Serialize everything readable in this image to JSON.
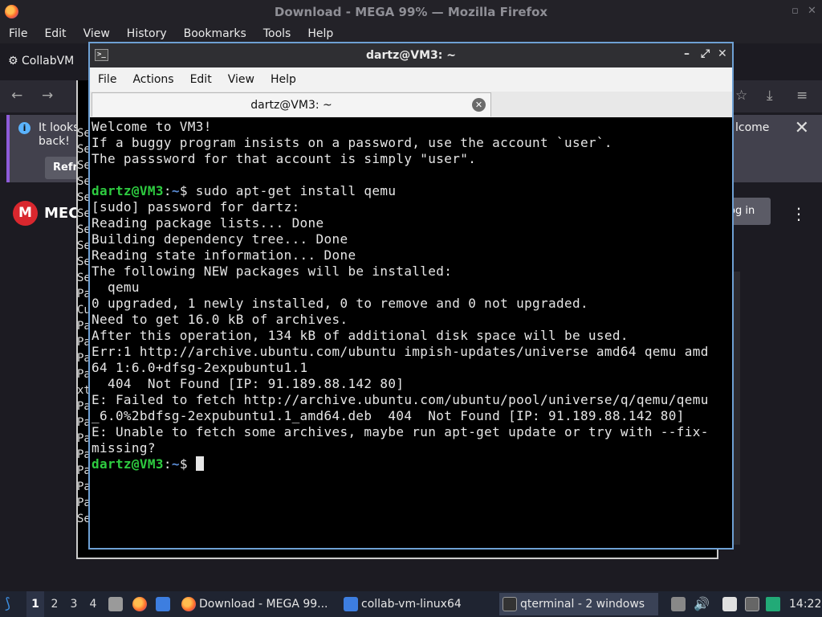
{
  "firefox": {
    "title": "Download - MEGA 99% — Mozilla Firefox",
    "menu": [
      "File",
      "Edit",
      "View",
      "History",
      "Bookmarks",
      "Tools",
      "Help"
    ],
    "tab_label": "CollabVM",
    "notification": {
      "line1": "It looks",
      "line2": "back!",
      "button": "Refresh",
      "right_text": "lcome"
    },
    "mega": {
      "logo_letter": "M",
      "brand_text": "MEC",
      "login_label": "og in"
    }
  },
  "bg_terminal": {
    "left_chars": [
      "Se",
      "Se",
      "Se",
      "Se",
      "Se",
      "Se",
      "Se",
      "Se",
      "Se",
      "Se",
      "Pa",
      "Cu",
      "Pa",
      "Pa",
      "Pa",
      "Pa",
      "xt",
      "Pa",
      "Pa",
      "Pa",
      "Pa",
      "Pa",
      "Pa",
      "Pa",
      "Se"
    ]
  },
  "qterminal": {
    "window_title": "dartz@VM3: ~",
    "menu": [
      "File",
      "Actions",
      "Edit",
      "View",
      "Help"
    ],
    "tab_title": "dartz@VM3: ~",
    "prompt_user": "dartz@VM3",
    "prompt_path": "~",
    "command": "sudo apt-get install qemu",
    "lines": [
      "Welcome to VM3!",
      "If a buggy program insists on a password, use the account `user`.",
      "The passsword for that account is simply \"user\".",
      "",
      "",
      "[sudo] password for dartz:",
      "Reading package lists... Done",
      "Building dependency tree... Done",
      "Reading state information... Done",
      "The following NEW packages will be installed:",
      "  qemu",
      "0 upgraded, 1 newly installed, 0 to remove and 0 not upgraded.",
      "Need to get 16.0 kB of archives.",
      "After this operation, 134 kB of additional disk space will be used.",
      "Err:1 http://archive.ubuntu.com/ubuntu impish-updates/universe amd64 qemu amd",
      "64 1:6.0+dfsg-2expubuntu1.1",
      "  404  Not Found [IP: 91.189.88.142 80]",
      "E: Failed to fetch http://archive.ubuntu.com/ubuntu/pool/universe/q/qemu/qemu",
      "_6.0%2bdfsg-2expubuntu1.1_amd64.deb  404  Not Found [IP: 91.189.88.142 80]",
      "E: Unable to fetch some archives, maybe run apt-get update or try with --fix-",
      "missing?"
    ]
  },
  "taskbar": {
    "workspaces": [
      "1",
      "2",
      "3",
      "4"
    ],
    "active_workspace": "1",
    "tasks": [
      "Download - MEGA 99...",
      "collab-vm-linux64",
      "qterminal - 2 windows"
    ],
    "clock": "14:22"
  },
  "colors": {
    "prompt_user": "#2ecc40",
    "prompt_path": "#5b8dd6",
    "terminal_border": "#6ea0d4",
    "notification_accent": "#8e5cd9"
  }
}
